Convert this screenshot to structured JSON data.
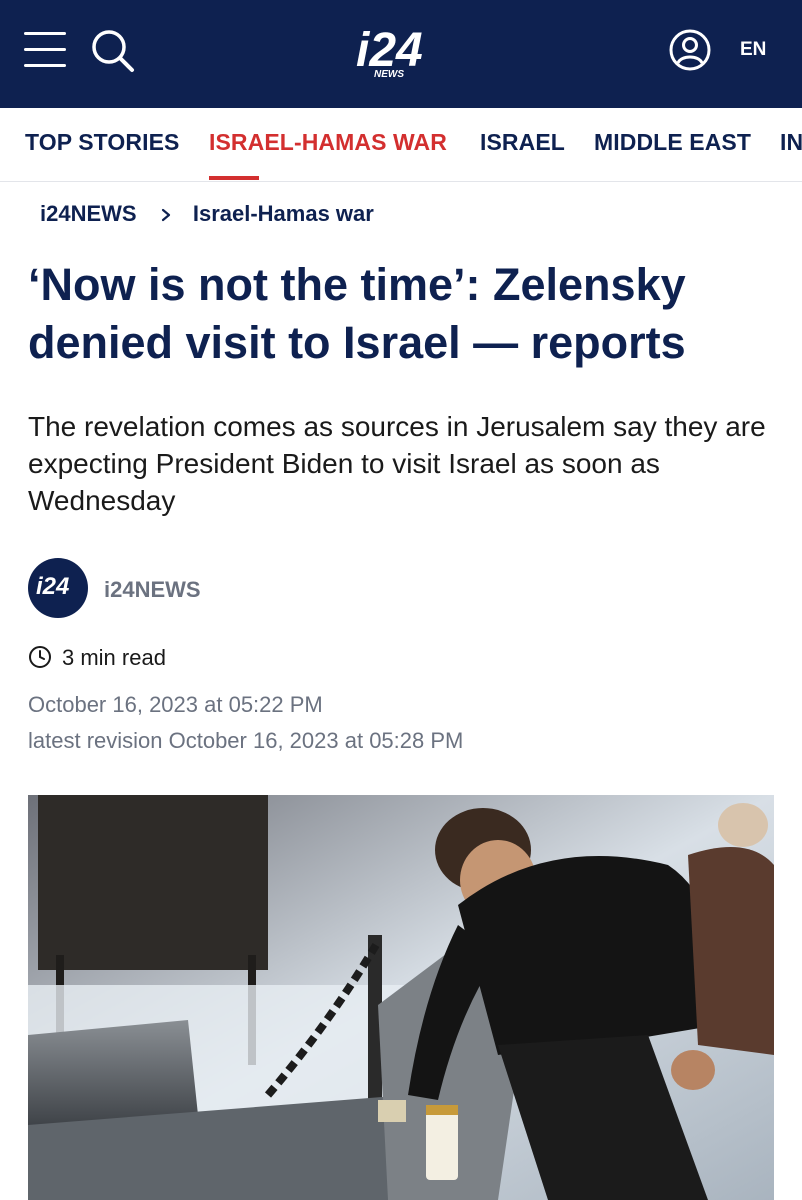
{
  "header": {
    "logo_text": "i24",
    "logo_sub": "NEWS",
    "lang": "EN",
    "icons": [
      "menu-icon",
      "search-icon",
      "account-icon"
    ],
    "bg_color": "#0e2150"
  },
  "nav": {
    "items": [
      {
        "label": "TOP STORIES",
        "active": false
      },
      {
        "label": "ISRAEL-HAMAS WAR",
        "active": true
      },
      {
        "label": "ISRAEL",
        "active": false
      },
      {
        "label": "MIDDLE EAST",
        "active": false
      },
      {
        "label": "IN",
        "active": false
      }
    ],
    "active_color": "#d32f2f"
  },
  "breadcrumb": {
    "home": "i24NEWS",
    "section": "Israel-Hamas war"
  },
  "article": {
    "title": "‘Now is not the time’: Zelensky denied visit to Israel — reports",
    "subtitle": "The revelation comes as sources in Jerusalem say they are expecting President Biden to visit Israel as soon as Wednesday",
    "author": "i24NEWS",
    "avatar_text": "i24",
    "read_time": "3 min read",
    "published": "October 16, 2023 at 05:22 PM",
    "revised": "latest revision October 16, 2023 at 05:28 PM"
  }
}
